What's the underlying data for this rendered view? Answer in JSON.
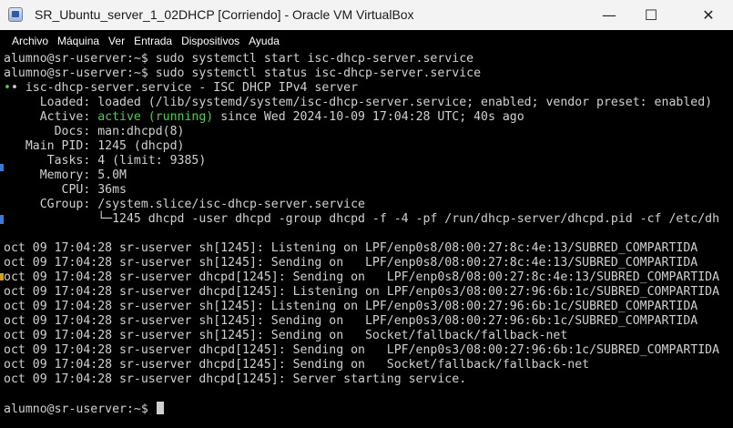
{
  "window": {
    "title": "SR_Ubuntu_server_1_02DHCP [Corriendo] - Oracle VM VirtualBox",
    "minimize_glyph": "—",
    "maximize_glyph": "☐",
    "close_glyph": "✕"
  },
  "menu": [
    "Archivo",
    "Máquina",
    "Ver",
    "Entrada",
    "Dispositivos",
    "Ayuda"
  ],
  "terminal": {
    "lines": [
      "alumno@sr-userver:~$ sudo systemctl start isc-dhcp-server.service",
      "alumno@sr-userver:~$ sudo systemctl status isc-dhcp-server.service",
      "• isc-dhcp-server.service - ISC DHCP IPv4 server",
      "     Loaded: loaded (/lib/systemd/system/isc-dhcp-server.service; enabled; vendor preset: enabled)",
      "     Active: ",
      "       Docs: man:dhcpd(8)",
      "   Main PID: 1245 (dhcpd)",
      "      Tasks: 4 (limit: 9385)",
      "     Memory: 5.0M",
      "        CPU: 36ms",
      "     CGroup: /system.slice/isc-dhcp-server.service",
      "             └─1245 dhcpd -user dhcpd -group dhcpd -f -4 -pf /run/dhcp-server/dhcpd.pid -cf /etc/dh",
      "",
      "oct 09 17:04:28 sr-userver sh[1245]: Listening on LPF/enp0s8/08:00:27:8c:4e:13/SUBRED_COMPARTIDA",
      "oct 09 17:04:28 sr-userver sh[1245]: Sending on   LPF/enp0s8/08:00:27:8c:4e:13/SUBRED_COMPARTIDA",
      "oct 09 17:04:28 sr-userver dhcpd[1245]: Sending on   LPF/enp0s8/08:00:27:8c:4e:13/SUBRED_COMPARTIDA",
      "oct 09 17:04:28 sr-userver dhcpd[1245]: Listening on LPF/enp0s3/08:00:27:96:6b:1c/SUBRED_COMPARTIDA",
      "oct 09 17:04:28 sr-userver sh[1245]: Listening on LPF/enp0s3/08:00:27:96:6b:1c/SUBRED_COMPARTIDA",
      "oct 09 17:04:28 sr-userver sh[1245]: Sending on   LPF/enp0s3/08:00:27:96:6b:1c/SUBRED_COMPARTIDA",
      "oct 09 17:04:28 sr-userver sh[1245]: Sending on   Socket/fallback/fallback-net",
      "oct 09 17:04:28 sr-userver dhcpd[1245]: Sending on   LPF/enp0s3/08:00:27:96:6b:1c/SUBRED_COMPARTIDA",
      "oct 09 17:04:28 sr-userver dhcpd[1245]: Sending on   Socket/fallback/fallback-net",
      "oct 09 17:04:28 sr-userver dhcpd[1245]: Server starting service.",
      "",
      "alumno@sr-userver:~$ "
    ],
    "active_status": "active (running)",
    "active_since": " since Wed 2024-10-09 17:04:28 UTC; 40s ago",
    "status_bullet": "•"
  },
  "colors": {
    "terminal_bg": "#000000",
    "terminal_text": "#d0d0d0",
    "active_green": "#4ec94e",
    "titlebar_bg": "#f3f3f3"
  },
  "icons": {
    "app": "virtualbox-icon",
    "minimize": "minimize-icon",
    "maximize": "maximize-icon",
    "close": "close-icon"
  }
}
